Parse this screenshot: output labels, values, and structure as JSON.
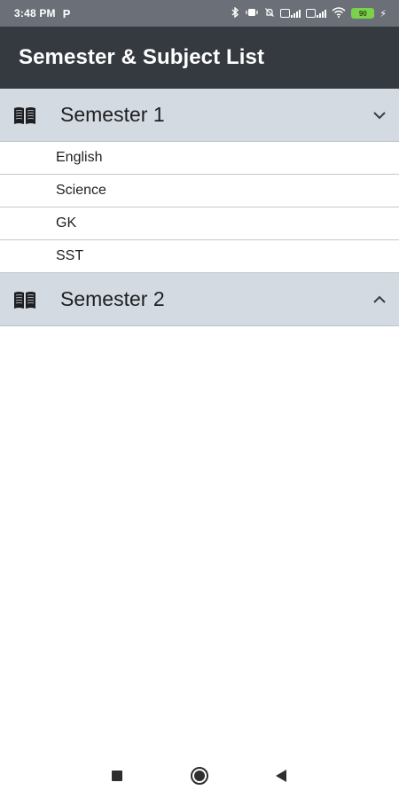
{
  "status_bar": {
    "time": "3:48 PM",
    "carrier_icon": "P",
    "battery_level": "90",
    "icons": [
      "bluetooth-icon",
      "vibrate-icon",
      "alarm-off-icon",
      "sim1-signal-icon",
      "sim2-signal-icon",
      "wifi-icon",
      "battery-icon",
      "charging-icon"
    ]
  },
  "app_bar": {
    "title": "Semester & Subject List"
  },
  "semesters": [
    {
      "title": "Semester 1",
      "expanded": true,
      "chevron": "chevron-down-icon",
      "subjects": [
        "English",
        "Science",
        "GK",
        "SST"
      ]
    },
    {
      "title": "Semester 2",
      "expanded": false,
      "chevron": "chevron-up-icon",
      "subjects": []
    }
  ],
  "nav_bar": {
    "buttons": [
      "recent-apps-icon",
      "home-icon",
      "back-icon"
    ]
  },
  "colors": {
    "status_bar": "#6b7078",
    "app_bar": "#353a41",
    "section_header": "#d3dae1",
    "battery": "#7ad14a"
  }
}
